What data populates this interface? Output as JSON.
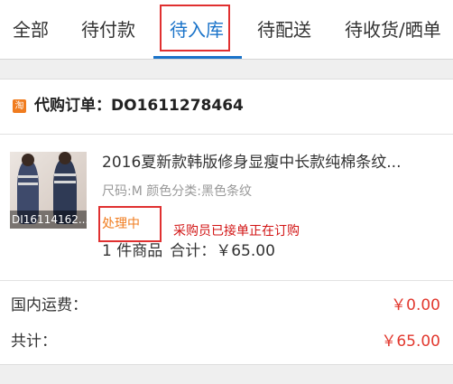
{
  "tabs": [
    {
      "label": "全部"
    },
    {
      "label": "待付款"
    },
    {
      "label": "待入库"
    },
    {
      "label": "待配送"
    },
    {
      "label": "待收货/晒单"
    }
  ],
  "active_tab": "待入库",
  "order": {
    "label": "代购订单：DO1611278464",
    "shop_icon_glyph": "淘"
  },
  "product": {
    "thumbnail_code": "DI16114162...",
    "title": "2016夏新款韩版修身显瘦中长款纯棉条纹...",
    "spec": "尺码:M 颜色分类:黑色条纹",
    "status": "处理中",
    "annotation": "采购员已接单正在订购",
    "quantity": "1 件商品",
    "total": "合计：￥65.00"
  },
  "fees": {
    "shipping_label": "国内运费：",
    "shipping_value": "￥0.00",
    "sum_label": "共计：",
    "sum_value": "￥65.00"
  },
  "colors": {
    "accent": "#1a73c9",
    "price": "#e2392f",
    "status": "#f07c1f",
    "highlight_box": "#e03030"
  }
}
